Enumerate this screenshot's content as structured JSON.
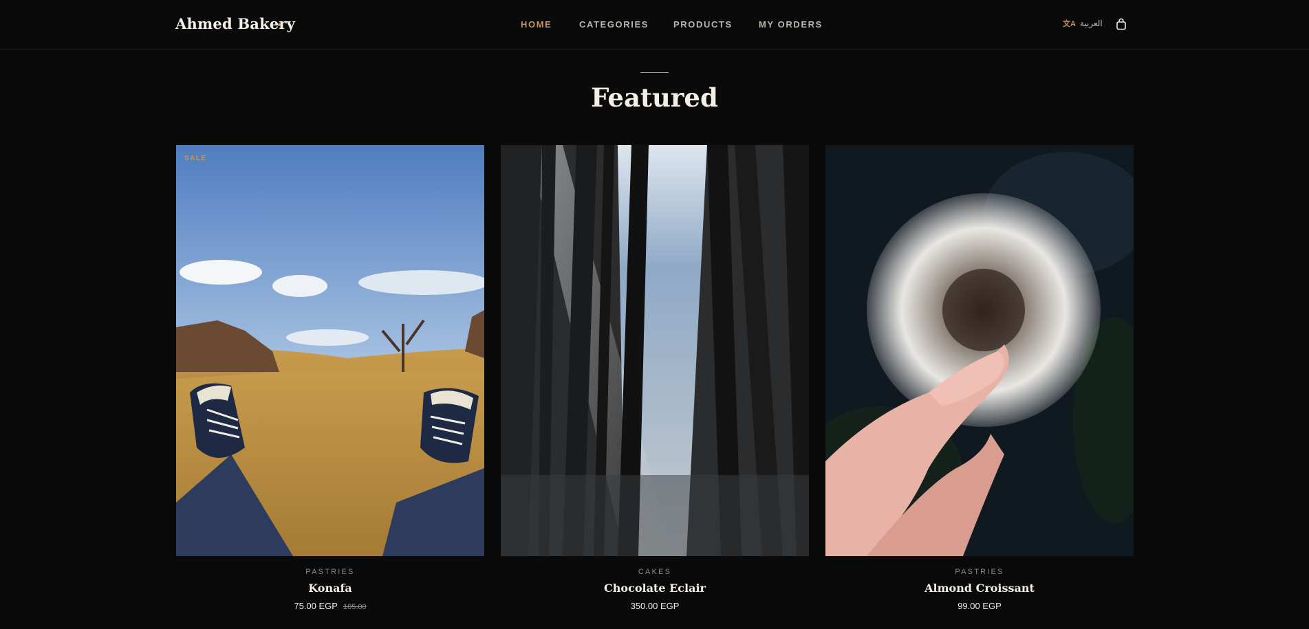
{
  "header": {
    "brand": "Ahmed Bakery",
    "nav": [
      {
        "label": "HOME",
        "active": true
      },
      {
        "label": "CATEGORIES",
        "active": false
      },
      {
        "label": "PRODUCTS",
        "active": false
      },
      {
        "label": "MY ORDERS",
        "active": false
      }
    ],
    "language_label": "العربية",
    "language_icon": "translate-icon",
    "cart_icon": "shopping-bag-icon"
  },
  "featured": {
    "title": "Featured",
    "products": [
      {
        "badge": "SALE",
        "category": "PASTRIES",
        "name": "Konafa",
        "price": "75.00 EGP",
        "old_price": "105.00",
        "image": "sneakers-in-field-photo"
      },
      {
        "badge": "",
        "category": "CAKES",
        "name": "Chocolate Eclair",
        "price": "350.00 EGP",
        "old_price": "",
        "image": "forest-trees-photo"
      },
      {
        "badge": "",
        "category": "PASTRIES",
        "name": "Almond Croissant",
        "price": "99.00 EGP",
        "old_price": "",
        "image": "dandelion-in-hand-photo"
      }
    ]
  },
  "colors": {
    "background": "#0a0a0a",
    "accent": "#c7955b",
    "text": "#f4efe6",
    "muted": "#8f8b84"
  }
}
